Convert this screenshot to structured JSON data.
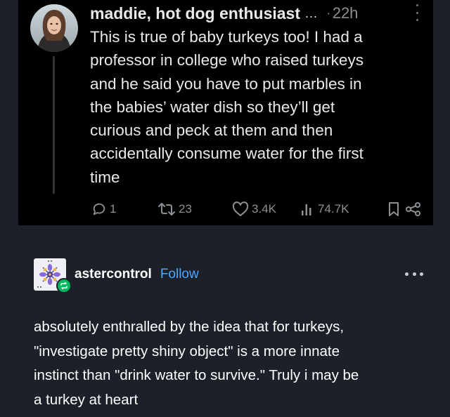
{
  "tweet": {
    "author_name": "maddie, hot dog enthusiast",
    "name_ellipsis": "...",
    "separator": "·",
    "time": "22h",
    "text": "This is true of baby turkeys too! I had a\nprofessor in college who raised turkeys\nand he said you have to put marbles in\nthe babies’ water dish so they’ll get\ncurious and peck at them and then\naccidentally consume water for the first\ntime",
    "actions": {
      "replies": "1",
      "retweets": "23",
      "likes": "3.4K",
      "views": "74.7K"
    },
    "icons": {
      "reply": "reply-icon",
      "retweet": "retweet-icon",
      "like": "heart-icon",
      "views": "views-chart-icon",
      "bookmark": "bookmark-icon",
      "share": "share-icon",
      "more": "more-vertical-icon"
    }
  },
  "reblog": {
    "username": "astercontrol",
    "follow_label": "Follow",
    "text": "absolutely enthralled by the idea that for turkeys,\n\"investigate pretty shiny object\" is a more innate\ninstinct than \"drink water to survive.\" Truly i may be\na turkey at heart",
    "icons": {
      "badge": "reblog-icon",
      "more": "more-horizontal-icon"
    }
  },
  "colors": {
    "page_background": "#1c2028",
    "tweet_background": "#000000",
    "muted_text": "#8b9095",
    "follow_link": "#4ea8ff",
    "reblog_badge": "#00b85f"
  }
}
